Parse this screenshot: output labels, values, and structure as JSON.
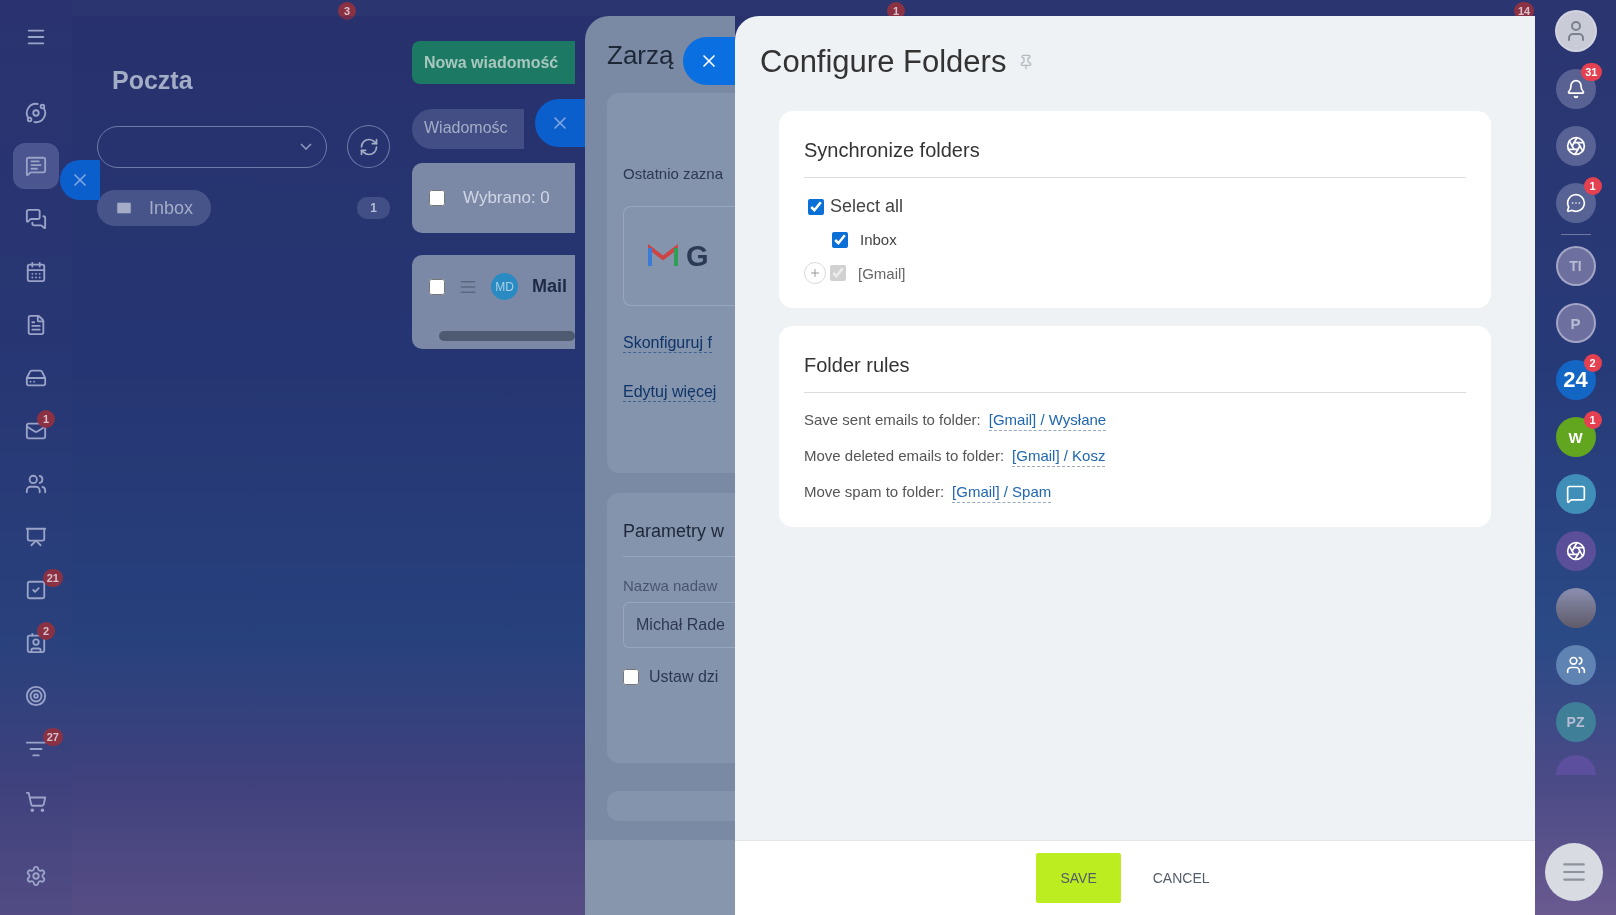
{
  "top_badges": [
    {
      "count": "3"
    },
    {
      "count": "1"
    },
    {
      "count": "14"
    }
  ],
  "left_nav": {
    "items": [
      {
        "selected": false
      },
      {
        "selected": true
      },
      {
        "selected": false
      },
      {
        "selected": false
      },
      {
        "selected": false
      },
      {
        "selected": false
      },
      {
        "selected": false,
        "badge": "1"
      },
      {
        "selected": false
      },
      {
        "selected": false
      },
      {
        "selected": false,
        "badge": "21"
      },
      {
        "selected": false,
        "badge": "2"
      },
      {
        "selected": false
      },
      {
        "selected": false,
        "badge": "27"
      },
      {
        "selected": false
      }
    ]
  },
  "mail_page": {
    "title": "Poczta",
    "new_button": "Nowa wiadomość",
    "filter": "Wiadomośc",
    "folders": [
      {
        "label": "Inbox",
        "count": "1",
        "selected": true
      }
    ],
    "selection": {
      "label": "Wybrano: 0",
      "checked": false
    },
    "rows": [
      {
        "avatar": "MD",
        "sender": "Mail",
        "checked": false
      }
    ]
  },
  "settings_panel": {
    "title": "Zarzą",
    "recent_label": "Ostatnio zazna",
    "provider": "G",
    "links": [
      "Skonfiguruj f",
      "Edytuj więcej"
    ],
    "section_title": "Parametry w",
    "field_label": "Nazwa nadaw",
    "field_value": "Michał Rade",
    "option": {
      "label": "Ustaw dzi",
      "checked": false
    }
  },
  "configure": {
    "title": "Configure Folders",
    "sections": [
      {
        "kind": "tree",
        "title": "Synchronize folders",
        "select_all": {
          "label": "Select all",
          "checked": true
        },
        "folders": [
          {
            "label": "Inbox",
            "checked": true,
            "disabled": false,
            "expandable": false
          },
          {
            "label": "[Gmail]",
            "checked": true,
            "disabled": true,
            "expandable": true,
            "expanded": false
          }
        ]
      },
      {
        "kind": "rules",
        "title": "Folder rules",
        "rules": [
          {
            "label": "Save sent emails to folder:",
            "value": "[Gmail] / Wysłane"
          },
          {
            "label": "Move deleted emails to folder:",
            "value": "[Gmail] / Kosz"
          },
          {
            "label": "Move spam to folder:",
            "value": "[Gmail] / Spam"
          }
        ]
      }
    ],
    "buttons": [
      {
        "label": "SAVE",
        "kind": "primary"
      },
      {
        "label": "CANCEL",
        "kind": "link"
      }
    ]
  },
  "right_bar": {
    "items": [
      {
        "kind": "avatar"
      },
      {
        "kind": "icon",
        "badge": "31"
      },
      {
        "kind": "icon"
      },
      {
        "kind": "icon",
        "badge": "1"
      },
      {
        "kind": "divider"
      },
      {
        "kind": "initials",
        "text": "TI",
        "color": "#6d6f9e"
      },
      {
        "kind": "initials",
        "text": "P",
        "color": "#6d6f9e"
      },
      {
        "kind": "initials",
        "text": "24",
        "badge": "2",
        "color": "#1366c4"
      },
      {
        "kind": "initials",
        "text": "W",
        "badge": "1",
        "color": "#62a51f"
      },
      {
        "kind": "icon",
        "color": "#3f8fb8"
      },
      {
        "kind": "icon",
        "color": "#5b4f9a"
      },
      {
        "kind": "photo"
      },
      {
        "kind": "icon",
        "color": "#5f83b3"
      },
      {
        "kind": "initials",
        "text": "PZ",
        "color": "#3f7f98"
      }
    ]
  }
}
